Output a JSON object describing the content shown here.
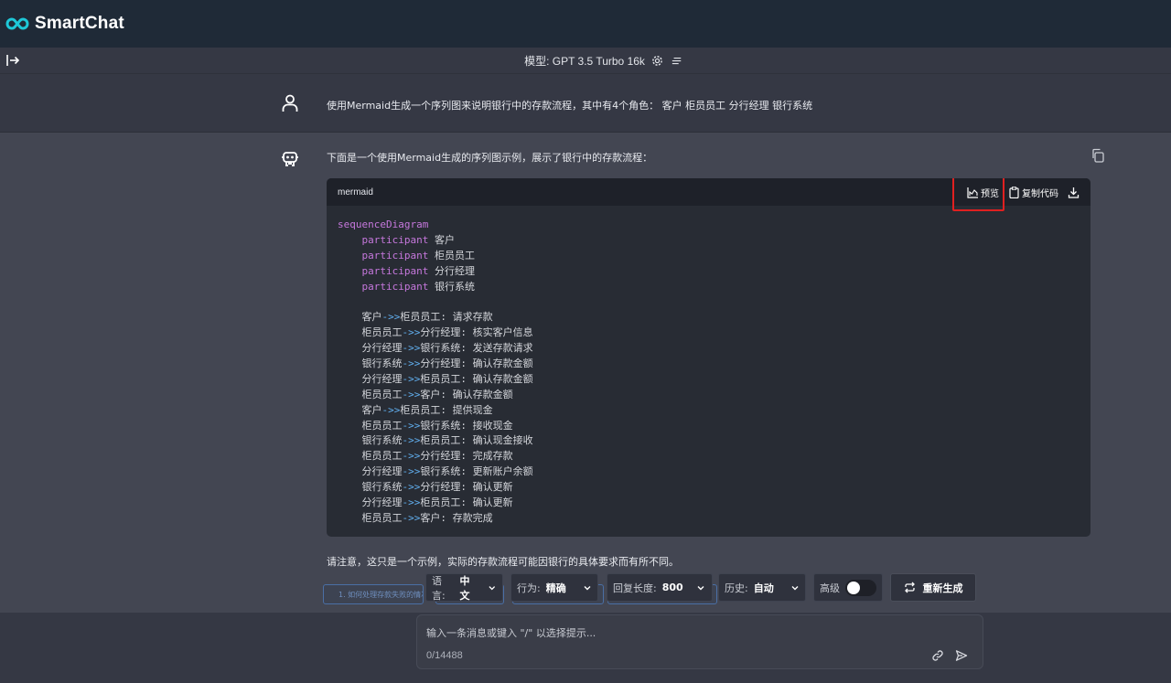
{
  "header": {
    "app_name": "SmartChat",
    "logo_icon": "infinity-logo-icon"
  },
  "model_bar": {
    "label": "模型: GPT 3.5 Turbo 16k",
    "toggle_icon": "sidebar-open-icon",
    "settings_icon": "gear-icon",
    "menu_icon": "menu-lines-icon"
  },
  "user_message": {
    "text": "使用Mermaid生成一个序列图来说明银行中的存款流程，其中有4个角色：  客户 柜员员工 分行经理 银行系统"
  },
  "assistant_message": {
    "intro": "下面是一个使用Mermaid生成的序列图示例，展示了银行中的存款流程：",
    "note": "请注意，这只是一个示例，实际的存款流程可能因银行的具体要求而有所不同。"
  },
  "code_block": {
    "language": "mermaid",
    "preview_label": "预览",
    "copy_label": "复制代码",
    "header": "sequenceDiagram",
    "participants": [
      "客户",
      "柜员员工",
      "分行经理",
      "银行系统"
    ],
    "messages": [
      {
        "from": "客户",
        "to": "柜员员工",
        "text": "请求存款"
      },
      {
        "from": "柜员员工",
        "to": "分行经理",
        "text": "核实客户信息"
      },
      {
        "from": "分行经理",
        "to": "银行系统",
        "text": "发送存款请求"
      },
      {
        "from": "银行系统",
        "to": "分行经理",
        "text": "确认存款金额"
      },
      {
        "from": "分行经理",
        "to": "柜员员工",
        "text": "确认存款金额"
      },
      {
        "from": "柜员员工",
        "to": "客户",
        "text": "确认存款金额"
      },
      {
        "from": "客户",
        "to": "柜员员工",
        "text": "提供现金"
      },
      {
        "from": "柜员员工",
        "to": "银行系统",
        "text": "接收现金"
      },
      {
        "from": "银行系统",
        "to": "柜员员工",
        "text": "确认现金接收"
      },
      {
        "from": "柜员员工",
        "to": "分行经理",
        "text": "完成存款"
      },
      {
        "from": "分行经理",
        "to": "银行系统",
        "text": "更新账户余额"
      },
      {
        "from": "银行系统",
        "to": "分行经理",
        "text": "确认更新"
      },
      {
        "from": "分行经理",
        "to": "柜员员工",
        "text": "确认更新"
      },
      {
        "from": "柜员员工",
        "to": "客户",
        "text": "存款完成"
      }
    ]
  },
  "suggestion": {
    "text": "1. 如何处理存款失败的情况？"
  },
  "controls": {
    "language": {
      "label": "语言:",
      "value": "中文"
    },
    "behavior": {
      "label": "行为:",
      "value": "精确"
    },
    "reply_length": {
      "label": "回复长度:",
      "value": "800"
    },
    "history": {
      "label": "历史:",
      "value": "自动"
    },
    "advanced": {
      "label": "高级"
    },
    "regenerate": {
      "label": "重新生成"
    }
  },
  "input": {
    "placeholder": "输入一条消息或键入 \"/\" 以选择提示...",
    "counter": "0/14488"
  },
  "colors": {
    "accent_logo": "#1ec8d8",
    "highlight_box": "#e02020",
    "keyword": "#c678dd",
    "arrow": "#61afef"
  }
}
